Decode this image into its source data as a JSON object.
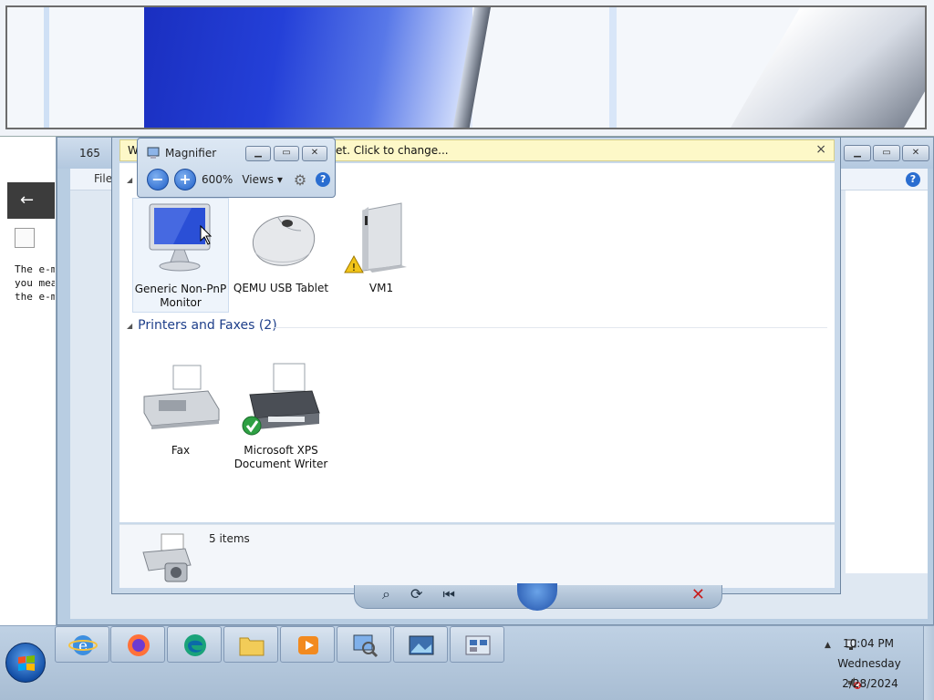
{
  "magnifier": {
    "title": "Magnifier",
    "zoom": "600%",
    "views_label": "Views"
  },
  "background_window": {
    "title": "165",
    "file_menu": "File",
    "text_lines": [
      "The e-m",
      "you mea",
      "the e-m"
    ]
  },
  "info_bar": {
    "text": "W… s and information from the Internet. Click to change...",
    "close": "×"
  },
  "devices_group": {
    "items": [
      {
        "label": "Generic Non-PnP Monitor",
        "name": "generic-non-pnp-monitor"
      },
      {
        "label": "QEMU USB Tablet",
        "name": "qemu-usb-tablet"
      },
      {
        "label": "VM1",
        "name": "vm1"
      }
    ]
  },
  "printers_group": {
    "header": "Printers and Faxes (2)",
    "items": [
      {
        "label": "Fax"
      },
      {
        "label": "Microsoft XPS Document Writer"
      }
    ]
  },
  "details_pane": {
    "count": "5 items"
  },
  "taskbar": {
    "items": [
      "internet-explorer",
      "firefox",
      "edge",
      "windows-explorer",
      "media-player",
      "magnifier",
      "photo-viewer",
      "devices-and-printers"
    ]
  },
  "tray": {
    "time": "10:04 PM",
    "day": "Wednesday",
    "date": "2/28/2024"
  },
  "colors": {
    "accent": "#1e3f8a",
    "infobar": "#fdf8c8",
    "taskbar": "#b8cbe0"
  }
}
